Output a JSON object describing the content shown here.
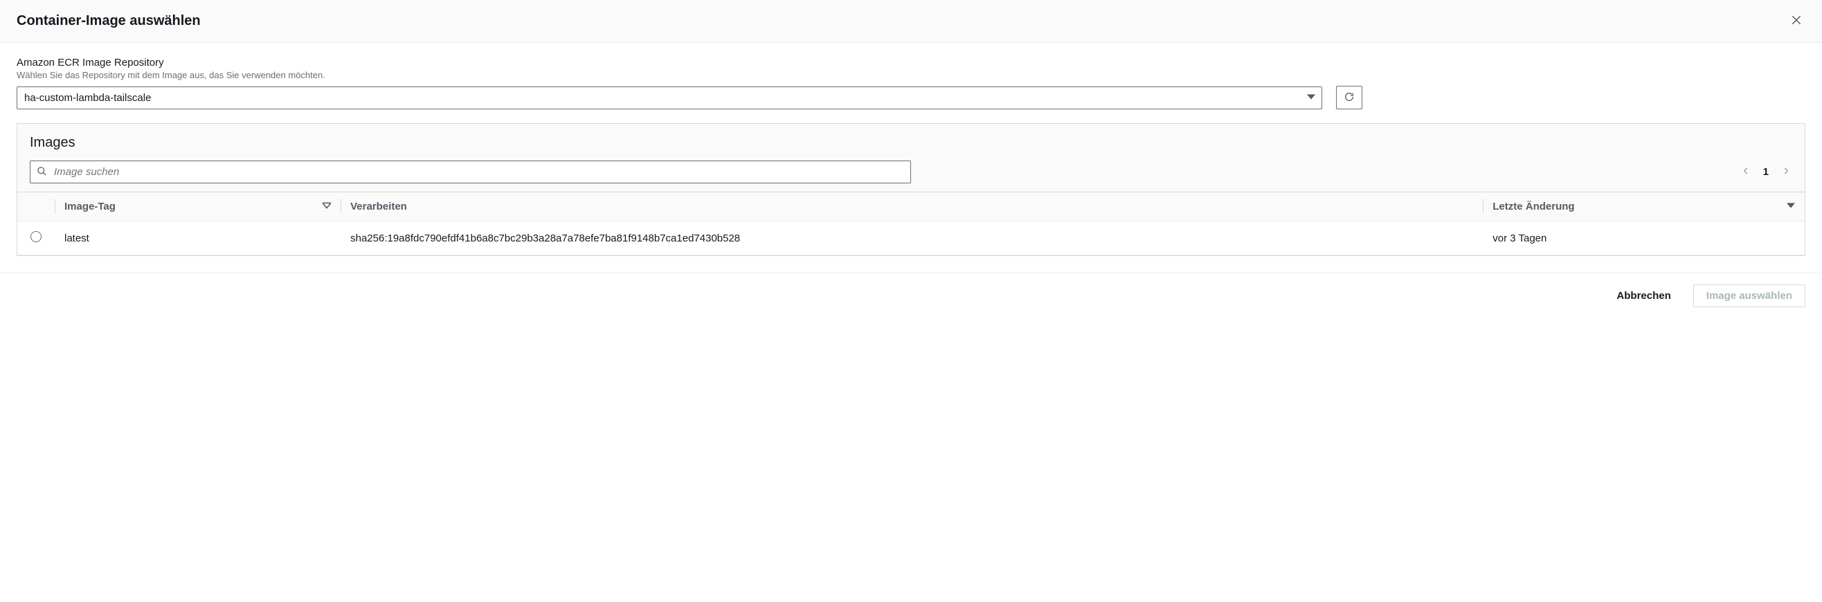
{
  "modal": {
    "title": "Container-Image auswählen"
  },
  "repo": {
    "label": "Amazon ECR Image Repository",
    "hint": "Wählen Sie das Repository mit dem Image aus, das Sie verwenden möchten.",
    "selected": "ha-custom-lambda-tailscale"
  },
  "imagesPanel": {
    "title": "Images",
    "searchPlaceholder": "Image suchen",
    "page": "1",
    "columns": {
      "tag": "Image-Tag",
      "digest": "Verarbeiten",
      "modified": "Letzte Änderung"
    },
    "rows": [
      {
        "tag": "latest",
        "digest": "sha256:19a8fdc790efdf41b6a8c7bc29b3a28a7a78efe7ba81f9148b7ca1ed7430b528",
        "modified": "vor 3 Tagen"
      }
    ]
  },
  "footer": {
    "cancel": "Abbrechen",
    "select": "Image auswählen"
  }
}
